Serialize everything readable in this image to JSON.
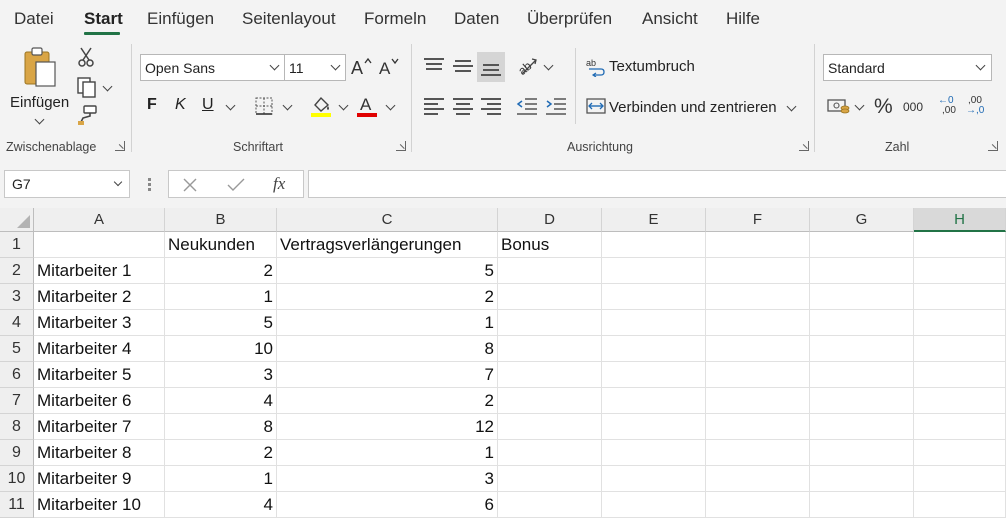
{
  "menu": {
    "tabs": [
      "Datei",
      "Start",
      "Einfügen",
      "Seitenlayout",
      "Formeln",
      "Daten",
      "Überprüfen",
      "Ansicht",
      "Hilfe"
    ],
    "active": "Start"
  },
  "ribbon": {
    "clipboard": {
      "paste_label": "Einfügen",
      "group_label": "Zwischenablage"
    },
    "font": {
      "font_name": "Open Sans",
      "font_size": "11",
      "bold": "F",
      "italic": "K",
      "underline": "U",
      "group_label": "Schriftart",
      "highlight_color": "#ffff00",
      "font_color": "#e00000"
    },
    "alignment": {
      "wrap_label": "Textumbruch",
      "merge_label": "Verbinden und zentrieren",
      "group_label": "Ausrichtung"
    },
    "number": {
      "format": "Standard",
      "percent": "%",
      "thousands": "000",
      "inc_decimal_top": "←0",
      "inc_decimal_bottom": ",00",
      "dec_decimal_top": ",00",
      "dec_decimal_bottom": "→,0",
      "group_label": "Zahl"
    }
  },
  "formula_bar": {
    "name_box": "G7",
    "fx": "fx",
    "value": ""
  },
  "sheet": {
    "columns": [
      "A",
      "B",
      "C",
      "D",
      "E",
      "F",
      "G",
      "H"
    ],
    "selected_column": "H",
    "rows": [
      [
        "",
        "Neukunden",
        "Vertragsverlängerungen",
        "Bonus",
        "",
        "",
        "",
        ""
      ],
      [
        "Mitarbeiter 1",
        "2",
        "5",
        "",
        "",
        "",
        "",
        ""
      ],
      [
        "Mitarbeiter 2",
        "1",
        "2",
        "",
        "",
        "",
        "",
        ""
      ],
      [
        "Mitarbeiter 3",
        "5",
        "1",
        "",
        "",
        "",
        "",
        ""
      ],
      [
        "Mitarbeiter 4",
        "10",
        "8",
        "",
        "",
        "",
        "",
        ""
      ],
      [
        "Mitarbeiter 5",
        "3",
        "7",
        "",
        "",
        "",
        "",
        ""
      ],
      [
        "Mitarbeiter 6",
        "4",
        "2",
        "",
        "",
        "",
        "",
        ""
      ],
      [
        "Mitarbeiter 7",
        "8",
        "12",
        "",
        "",
        "",
        "",
        ""
      ],
      [
        "Mitarbeiter 8",
        "2",
        "1",
        "",
        "",
        "",
        "",
        ""
      ],
      [
        "Mitarbeiter 9",
        "1",
        "3",
        "",
        "",
        "",
        "",
        ""
      ],
      [
        "Mitarbeiter 10",
        "4",
        "6",
        "",
        "",
        "",
        "",
        ""
      ]
    ],
    "row_numbers": [
      "1",
      "2",
      "3",
      "4",
      "5",
      "6",
      "7",
      "8",
      "9",
      "10",
      "11"
    ],
    "accent": "#217346"
  }
}
